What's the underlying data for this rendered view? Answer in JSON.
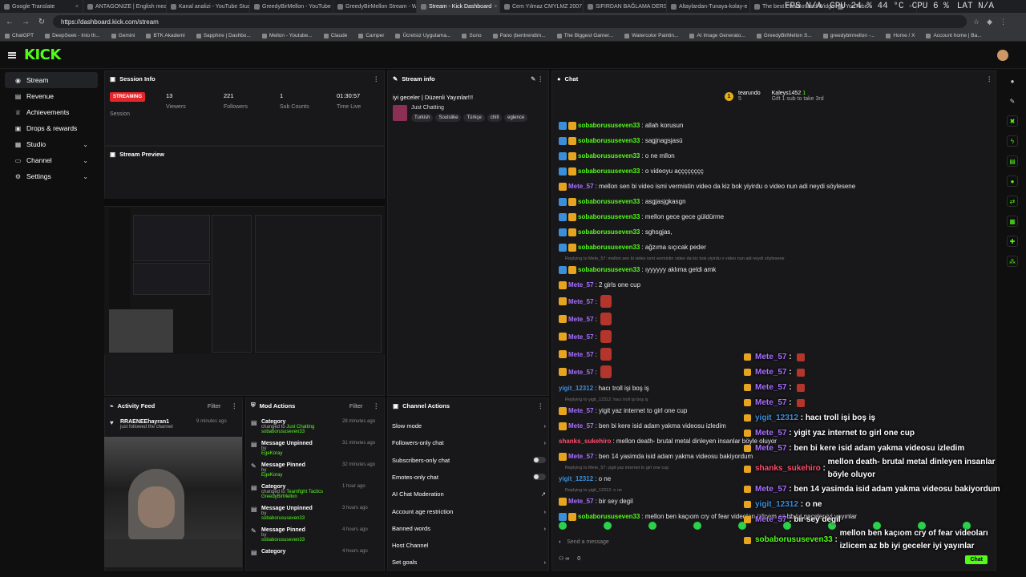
{
  "browser": {
    "tabs": [
      "Google Translate",
      "ANTAGONIZE | English mean",
      "Kanal analizi - YouTube Studio",
      "GreedyBirMellon - YouTube",
      "GreedyBirMellon Stream - W",
      "Stream - Kick Dashboard",
      "Cem Yılmaz CMYLMZ 2007",
      "SIFIRDAN BAĞLAMA DERSLE",
      "Altaylardan-Tunaya-kolay-e",
      "The best ChatBot and Widge",
      "YouTube"
    ],
    "url": "https://dashboard.kick.com/stream",
    "bookmarks": [
      "ChatGPT",
      "DeepSeek - Into th...",
      "Gemini",
      "BTK Akademi",
      "Sapphire | Dashbo...",
      "Mellon - Youtube...",
      "Claude",
      "Camper",
      "Ücretsiz Uygulama...",
      "Suno",
      "Pano (bentrendim...",
      "The Biggest Gamer...",
      "Watercolor Paintin...",
      "AI Image Generato...",
      "GreedyBirMellon S...",
      "greedybirmellon -...",
      "Home / X",
      "Account home | Ba..."
    ]
  },
  "overlay_stats": {
    "fps": "FPS N/A",
    "gpu": "GPU 24 % 44 °C",
    "cpu": "CPU 6 %",
    "lat": "LAT N/A"
  },
  "brand": {
    "logo": "KICK",
    "accent": "#53fc18"
  },
  "sidebar": {
    "items": [
      {
        "label": "Stream",
        "icon": "stream-icon"
      },
      {
        "label": "Revenue",
        "icon": "revenue-icon"
      },
      {
        "label": "Achievements",
        "icon": "trophy-icon"
      },
      {
        "label": "Drops & rewards",
        "icon": "gift-icon"
      },
      {
        "label": "Studio",
        "icon": "studio-icon"
      },
      {
        "label": "Channel",
        "icon": "channel-icon"
      },
      {
        "label": "Settings",
        "icon": "gear-icon"
      }
    ]
  },
  "session": {
    "title": "Session Info",
    "badge": "STREAMING",
    "session_label": "Session",
    "stats": [
      {
        "value": "13",
        "label": "Viewers"
      },
      {
        "value": "221",
        "label": "Followers"
      },
      {
        "value": "1",
        "label": "Sub Counts"
      },
      {
        "value": "01:30:57",
        "label": "Time Live"
      }
    ]
  },
  "preview": {
    "title": "Stream Preview"
  },
  "stream_info": {
    "title": "Stream info",
    "stream_title": "iyi geceler | Düzenli Yayınlar!!!",
    "category": "Just Chatting",
    "tags": [
      "Turkish",
      "Soulslike",
      "Türkçe",
      "chill",
      "eglence"
    ]
  },
  "chat": {
    "title": "Chat",
    "gift": {
      "user1": "tearundo",
      "count1": "5",
      "user2": "Kaleys1452",
      "count2": "1",
      "note": "Gift 1 sub to take 3rd"
    },
    "messages": [
      {
        "user": "sobaborususeven33",
        "color": "#53fc18",
        "text": "allah korusun",
        "badges": 2
      },
      {
        "user": "sobaborususeven33",
        "color": "#53fc18",
        "text": "sagjnagsjasü",
        "badges": 2
      },
      {
        "user": "sobaborususeven33",
        "color": "#53fc18",
        "text": "o ne mllon",
        "badges": 2
      },
      {
        "user": "sobaborususeven33",
        "color": "#53fc18",
        "text": "o videoyu açççççççç",
        "badges": 2
      },
      {
        "user": "Mete_57",
        "color": "#a970ff",
        "text": "mellon sen bi video ismi vermistin video da kiz bok yiyirdu o video nun adi neydi söylesene",
        "badges": 1
      },
      {
        "user": "sobaborususeven33",
        "color": "#53fc18",
        "text": "asgjasjgkasgn",
        "badges": 2
      },
      {
        "user": "sobaborususeven33",
        "color": "#53fc18",
        "text": "mellon gece gece güldürme",
        "badges": 2
      },
      {
        "user": "sobaborususeven33",
        "color": "#53fc18",
        "text": "sghsgjas,",
        "badges": 2
      },
      {
        "user": "sobaborususeven33",
        "color": "#53fc18",
        "text": "ağzıma sıçıcak peder",
        "badges": 2
      },
      {
        "reply": "Replying to Mete_57: mellon sen bi video ismi vermistin video da kiz bok yiyirdu o video nun adi neydi söylesene"
      },
      {
        "user": "sobaborususeven33",
        "color": "#53fc18",
        "text": "ıyyyyyy aklıma geldi amk",
        "badges": 2
      },
      {
        "user": "Mete_57",
        "color": "#a970ff",
        "text": "2 girls one cup",
        "badges": 1
      },
      {
        "user": "Mete_57",
        "color": "#a970ff",
        "text": "",
        "emote": true,
        "badges": 1
      },
      {
        "user": "Mete_57",
        "color": "#a970ff",
        "text": "",
        "emote": true,
        "badges": 1
      },
      {
        "user": "Mete_57",
        "color": "#a970ff",
        "text": "",
        "emote": true,
        "badges": 1
      },
      {
        "user": "Mete_57",
        "color": "#a970ff",
        "text": "",
        "emote": true,
        "badges": 1
      },
      {
        "user": "Mete_57",
        "color": "#a970ff",
        "text": "",
        "emote": true,
        "badges": 1
      },
      {
        "user": "yigit_12312",
        "color": "#3b8fd9",
        "text": "hacı troll işi boş iş",
        "badges": 0
      },
      {
        "reply": "Replying to yigit_12312: hacı troll işi boş iş"
      },
      {
        "user": "Mete_57",
        "color": "#a970ff",
        "text": "yigit yaz internet to girl one cup",
        "badges": 1
      },
      {
        "user": "Mete_57",
        "color": "#a970ff",
        "text": "ben bi kere isid adam yakma videosu izledim",
        "badges": 1
      },
      {
        "user": "shanks_sukehiro",
        "color": "#ff4f6d",
        "text": "mellon death- brutal metal dinleyen insanlar böyle oluyor",
        "badges": 0
      },
      {
        "user": "Mete_57",
        "color": "#a970ff",
        "text": "ben 14 yasimda isid adam yakma videosu bakiyordum",
        "badges": 1
      },
      {
        "reply": "Replying to Mete_57: yigit yaz internet to girl one cup"
      },
      {
        "user": "yigit_12312",
        "color": "#3b8fd9",
        "text": "o ne",
        "badges": 0
      },
      {
        "reply": "Replying to yigit_12312: o ne"
      },
      {
        "user": "Mete_57",
        "color": "#a970ff",
        "text": "bir sey degil",
        "badges": 1
      },
      {
        "user": "sobaborususeven33",
        "color": "#53fc18",
        "text": "mellon ben kaçıom cry of fear videoları izlicem az bb iyi geceler iyi yayınlar",
        "badges": 2
      }
    ],
    "input_placeholder": "Send a message",
    "footer_count": "0",
    "chat_button": "Chat"
  },
  "activity": {
    "title": "Activity Feed",
    "filter": "Filter",
    "items": [
      {
        "user": "RRAENEEhayran1",
        "text": "just followed the channel",
        "time": "9 minutes ago"
      }
    ]
  },
  "mod_actions": {
    "title": "Mod Actions",
    "filter": "Filter",
    "items": [
      {
        "title": "Category",
        "line1": "changed to",
        "value": "Just Chatting",
        "by": "sobaborususeven33",
        "time": "28 minutes ago"
      },
      {
        "title": "Message Unpinned",
        "line1": "by",
        "value": "",
        "by": "EgeKoray",
        "time": "31 minutes ago"
      },
      {
        "title": "Message Pinned",
        "line1": "by",
        "value": "",
        "by": "EgeKoray",
        "time": "32 minutes ago"
      },
      {
        "title": "Category",
        "line1": "changed to",
        "value": "Teamfight Tactics",
        "by": "GreedyBirMellon",
        "time": "1 hour ago"
      },
      {
        "title": "Message Unpinned",
        "line1": "by",
        "value": "",
        "by": "sobaborususeven33",
        "time": "3 hours ago"
      },
      {
        "title": "Message Pinned",
        "line1": "by",
        "value": "",
        "by": "sobaborususeven33",
        "time": "4 hours ago"
      },
      {
        "title": "Category",
        "line1": "",
        "value": "",
        "by": "",
        "time": "4 hours ago"
      }
    ]
  },
  "channel_actions": {
    "title": "Channel Actions",
    "items": [
      {
        "label": "Slow mode",
        "kind": "chevron"
      },
      {
        "label": "Followers-only chat",
        "kind": "chevron"
      },
      {
        "label": "Subscribers-only chat",
        "kind": "toggle"
      },
      {
        "label": "Emotes-only chat",
        "kind": "toggle"
      },
      {
        "label": "AI Chat Moderation",
        "kind": "external"
      },
      {
        "label": "Account age restriction",
        "kind": "chevron"
      },
      {
        "label": "Banned words",
        "kind": "chevron"
      },
      {
        "label": "Host Channel",
        "kind": "none"
      },
      {
        "label": "Set goals",
        "kind": "chevron"
      }
    ]
  },
  "overlay_chat": [
    {
      "user": "Mete_57",
      "color": "#a970ff",
      "text": "",
      "emote": true
    },
    {
      "user": "Mete_57",
      "color": "#a970ff",
      "text": "",
      "emote": true
    },
    {
      "user": "Mete_57",
      "color": "#a970ff",
      "text": "",
      "emote": true
    },
    {
      "user": "Mete_57",
      "color": "#a970ff",
      "text": "",
      "emote": true
    },
    {
      "user": "yigit_12312",
      "color": "#3b8fd9",
      "text": "hacı troll işi boş iş"
    },
    {
      "user": "Mete_57",
      "color": "#a970ff",
      "text": "yigit yaz internet to girl one cup"
    },
    {
      "user": "Mete_57",
      "color": "#a970ff",
      "text": "ben bi kere isid adam yakma videosu izledim"
    },
    {
      "user": "shanks_sukehiro",
      "color": "#ff4f6d",
      "text": "mellon death- brutal metal dinleyen insanlar böyle oluyor",
      "wrap": true
    },
    {
      "user": "Mete_57",
      "color": "#a970ff",
      "text": "ben 14 yasimda isid adam yakma videosu bakiyordum"
    },
    {
      "user": "yigit_12312",
      "color": "#3b8fd9",
      "text": "o ne"
    },
    {
      "user": "Mete_57",
      "color": "#a970ff",
      "text": "bir sey degil"
    },
    {
      "user": "sobaborususeven33",
      "color": "#53fc18",
      "text": "mellon ben kaçıom cry of fear videoları izlicem az bb iyi geceler iyi yayınlar",
      "wrap": true
    }
  ]
}
